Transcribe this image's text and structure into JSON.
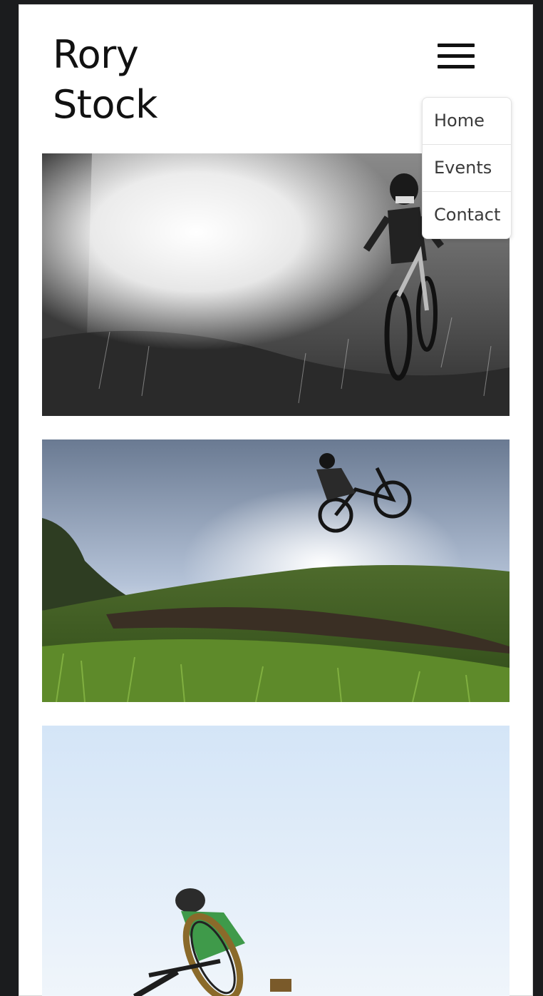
{
  "site": {
    "title_line1": "Rory",
    "title_line2": "Stock"
  },
  "menu": {
    "icon": "hamburger-menu-icon",
    "items": [
      {
        "label": "Home"
      },
      {
        "label": "Events"
      },
      {
        "label": "Contact"
      }
    ]
  },
  "gallery": [
    {
      "name": "rider-trail-bw-photo"
    },
    {
      "name": "rider-jump-sky-photo"
    },
    {
      "name": "rider-wheelie-sky-photo"
    }
  ]
}
